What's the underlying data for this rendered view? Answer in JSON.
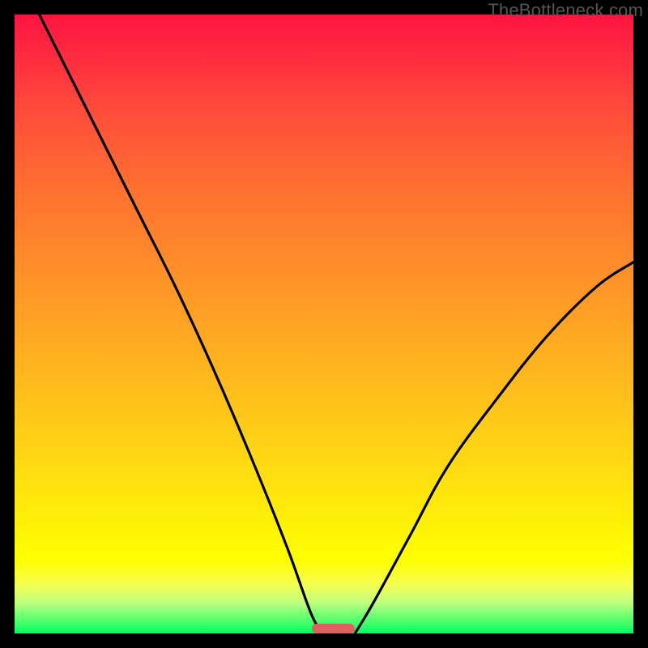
{
  "watermark": "TheBottleneck.com",
  "chart_data": {
    "type": "line",
    "title": "",
    "xlabel": "",
    "ylabel": "",
    "xlim": [
      0,
      100
    ],
    "ylim": [
      0,
      100
    ],
    "grid": false,
    "legend": false,
    "series": [
      {
        "name": "left-curve",
        "points": [
          {
            "x": 4,
            "y": 100
          },
          {
            "x": 8,
            "y": 92
          },
          {
            "x": 14,
            "y": 80
          },
          {
            "x": 20,
            "y": 68
          },
          {
            "x": 26,
            "y": 56
          },
          {
            "x": 32,
            "y": 43
          },
          {
            "x": 38,
            "y": 29
          },
          {
            "x": 44,
            "y": 14
          },
          {
            "x": 48,
            "y": 3
          },
          {
            "x": 50,
            "y": 0
          }
        ]
      },
      {
        "name": "right-curve",
        "points": [
          {
            "x": 55,
            "y": 0
          },
          {
            "x": 58,
            "y": 5
          },
          {
            "x": 64,
            "y": 16
          },
          {
            "x": 70,
            "y": 27
          },
          {
            "x": 78,
            "y": 38
          },
          {
            "x": 86,
            "y": 48
          },
          {
            "x": 94,
            "y": 56
          },
          {
            "x": 100,
            "y": 60
          }
        ]
      }
    ],
    "marker": {
      "x_start": 48,
      "x_end": 55,
      "y": 0,
      "color": "#e06060"
    }
  },
  "colors": {
    "background": "#000000",
    "curve": "#000000",
    "marker": "#e06060",
    "watermark": "#555555"
  }
}
